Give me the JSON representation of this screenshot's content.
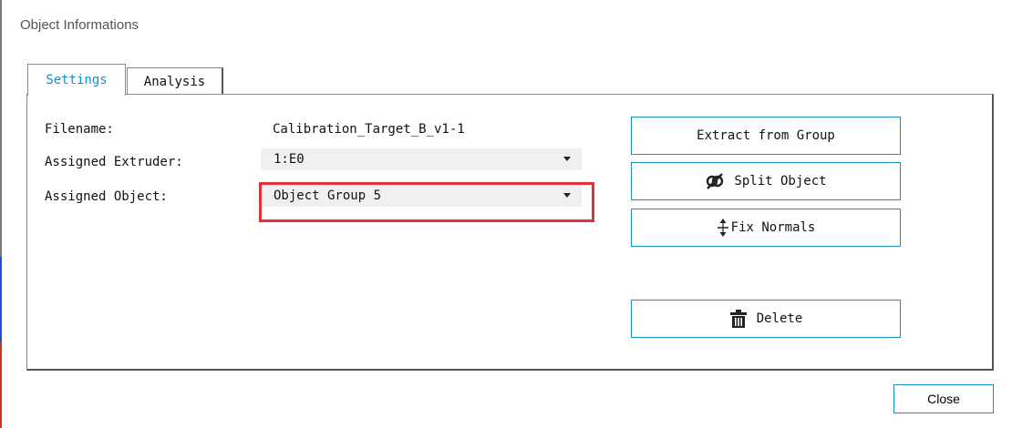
{
  "window": {
    "title": "Object Informations"
  },
  "tabs": [
    {
      "label": "Settings",
      "active": true
    },
    {
      "label": "Analysis",
      "active": false
    }
  ],
  "settings": {
    "filename_label": "Filename:",
    "filename_value": "Calibration_Target_B_v1-1",
    "extruder_label": "Assigned Extruder:",
    "extruder_value": "1:E0",
    "object_label": "Assigned Object:",
    "object_value": "Object Group 5"
  },
  "actions": {
    "extract": "Extract from Group",
    "split": "Split Object",
    "fix_normals": "Fix Normals",
    "delete": "Delete"
  },
  "footer": {
    "close": "Close"
  },
  "colors": {
    "accent": "#1a8fc4",
    "highlight": "#e8303a",
    "combo_bg": "#f0f0f0"
  },
  "icons": {
    "split": "split-object-icon",
    "fix_normals": "fix-normals-icon",
    "delete": "trash-icon"
  }
}
